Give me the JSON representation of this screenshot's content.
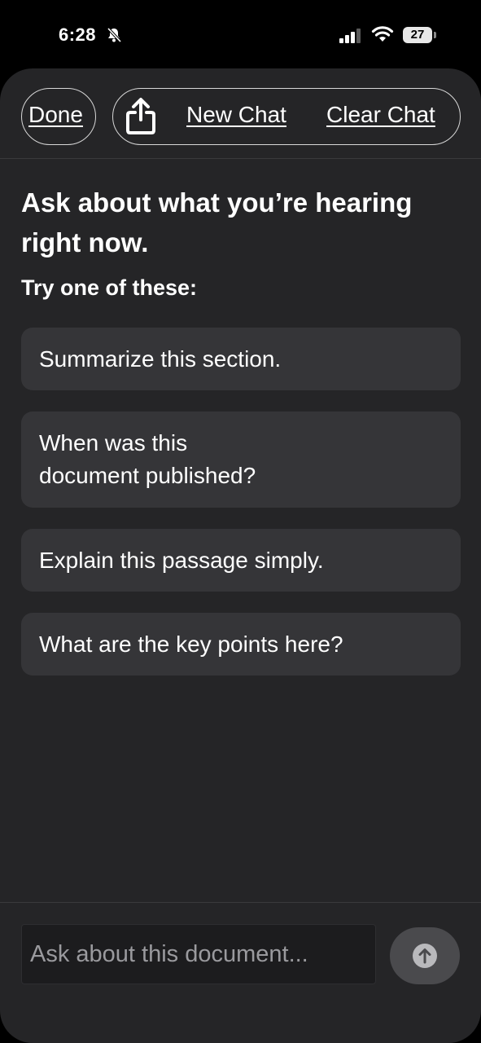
{
  "status_bar": {
    "time": "6:28",
    "battery_level": "27",
    "icons": [
      "bell-slash-icon",
      "cellular-signal-icon",
      "wifi-icon",
      "battery-icon"
    ]
  },
  "header": {
    "done_label": "Done",
    "share_icon": "share-icon",
    "new_chat_label": "New Chat",
    "clear_chat_label": "Clear Chat"
  },
  "main": {
    "title": "Ask about what you’re hearing right now.",
    "subtitle": "Try one of these:",
    "suggestions": [
      "Summarize this section.",
      "When was this document published?",
      "Explain this passage simply.",
      "What are the key points here?"
    ]
  },
  "composer": {
    "placeholder": "Ask about this document...",
    "send_icon": "arrow-up-icon"
  },
  "colors": {
    "sheet_background": "#252527",
    "suggestion_background": "#353538",
    "text": "#ffffff",
    "placeholder": "#9a9a9e"
  }
}
